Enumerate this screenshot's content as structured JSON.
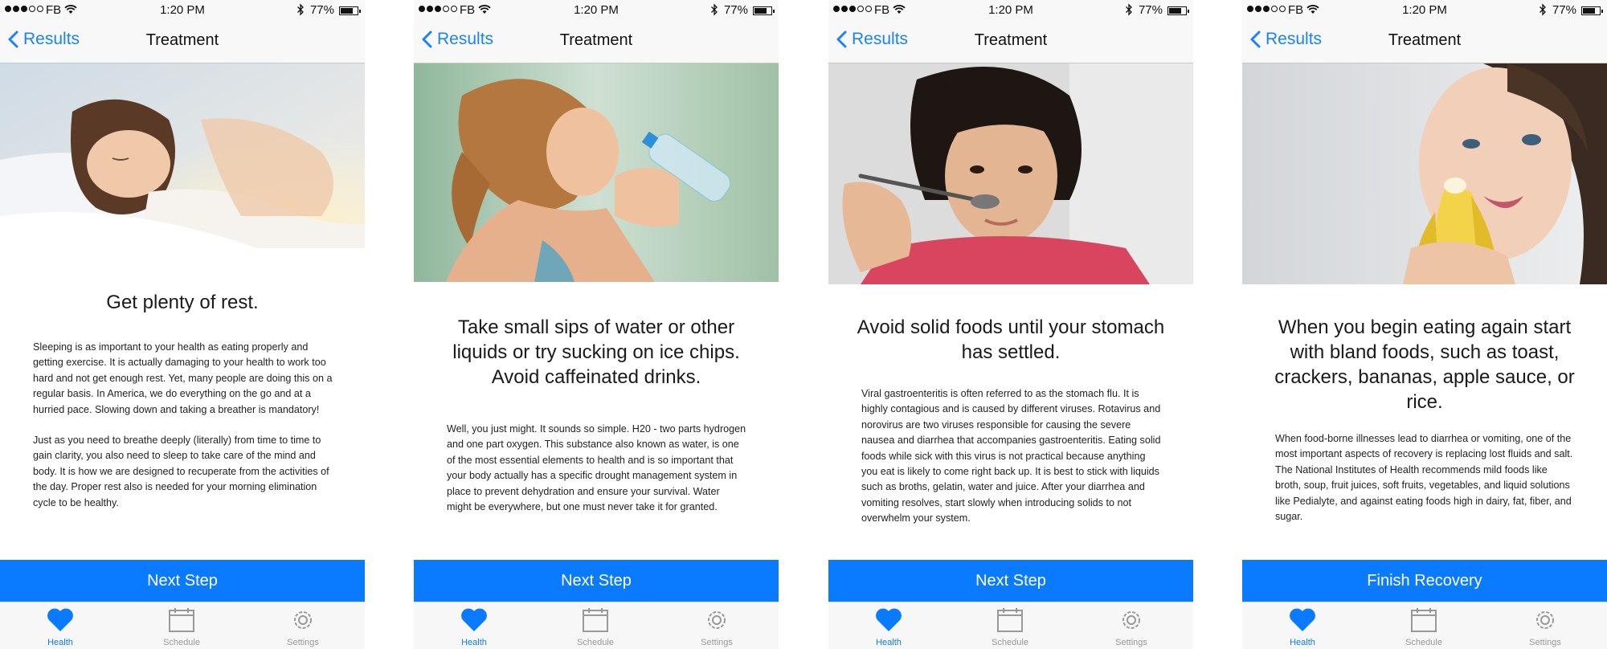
{
  "status": {
    "carrier": "FB",
    "time": "1:20 PM",
    "battery": "77%",
    "battery_level": 0.77
  },
  "nav": {
    "back_label": "Results",
    "title": "Treatment"
  },
  "tabs": [
    {
      "label": "Health"
    },
    {
      "label": "Schedule"
    },
    {
      "label": "Settings"
    }
  ],
  "colors": {
    "accent": "#0a7afe"
  },
  "screens": [
    {
      "headline": "Get plenty of rest.",
      "paragraphs": [
        "Sleeping is as important to your health as eating properly and getting exercise. It is actually damaging to your health to work too hard and not get enough rest. Yet, many people are doing this on a regular basis. In America, we do everything on the go and at a hurried pace. Slowing down and taking a breather is mandatory!",
        "Just as you need to breathe deeply (literally) from time to time to gain clarity, you also need to sleep to take care of the mind and body. It is how we are designed to recuperate from the activities of the day. Proper rest also is needed for your morning elimination cycle to be healthy."
      ],
      "button": "Next Step"
    },
    {
      "headline": "Take small sips of water or other liquids or try sucking on ice chips. Avoid caffeinated drinks.",
      "paragraphs": [
        "Well, you just might. It sounds so simple. H20 - two parts hydrogen and one part oxygen. This substance also known as water, is one of the most essential elements to health and is so important that your body actually has a specific drought management system in place to prevent dehydration and ensure your survival. Water might be everywhere, but one must never take it for granted."
      ],
      "button": "Next Step"
    },
    {
      "headline": "Avoid solid foods until your stomach has settled.",
      "paragraphs": [
        "Viral gastroenteritis is often referred to as the stomach flu. It is highly contagious and is caused by different viruses. Rotavirus and norovirus are two viruses responsible for causing the severe nausea and diarrhea that accompanies gastroenteritis. Eating solid foods while sick with this virus is not practical because anything you eat is likely to come right back up. It is best to stick with liquids such as broths, gelatin, water and juice. After your diarrhea and vomiting resolves, start slowly when introducing solids to not overwhelm your system."
      ],
      "button": "Next Step"
    },
    {
      "headline": "When you begin eating again start with bland foods, such as toast, crackers, bananas, apple sauce, or rice.",
      "paragraphs": [
        "When food-borne illnesses lead to diarrhea or vomiting, one of the most important aspects of recovery is replacing lost fluids and salt. The National Institutes of Health recommends mild foods like broth, soup, fruit juices, soft fruits, vegetables, and liquid solutions like Pedialyte, and against eating foods high in dairy, fat, fiber, and sugar."
      ],
      "button": "Finish Recovery"
    }
  ]
}
